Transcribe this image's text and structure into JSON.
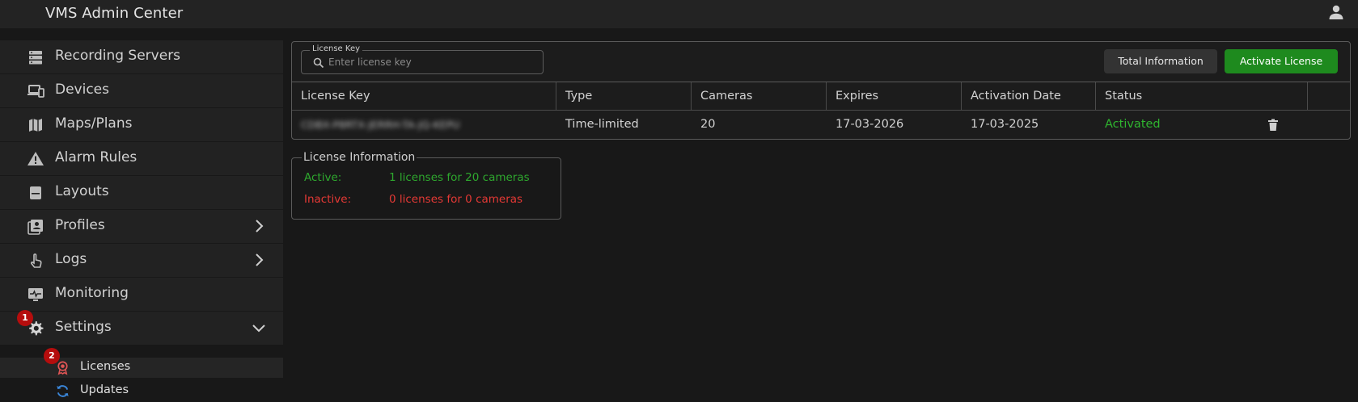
{
  "app": {
    "title": "VMS Admin Center"
  },
  "sidebar": {
    "items": [
      {
        "label": "Recording Servers",
        "icon": "server-icon"
      },
      {
        "label": "Devices",
        "icon": "devices-icon"
      },
      {
        "label": "Maps/Plans",
        "icon": "map-icon"
      },
      {
        "label": "Alarm Rules",
        "icon": "warning-icon"
      },
      {
        "label": "Layouts",
        "icon": "layout-icon"
      },
      {
        "label": "Profiles",
        "icon": "profiles-icon"
      },
      {
        "label": "Logs",
        "icon": "logs-icon"
      },
      {
        "label": "Monitoring",
        "icon": "monitor-icon"
      },
      {
        "label": "Settings",
        "icon": "gear-icon",
        "badge": "1"
      }
    ],
    "settings_sub": [
      {
        "label": "Licenses",
        "icon": "license-icon",
        "badge": "2"
      },
      {
        "label": "Updates",
        "icon": "refresh-icon"
      }
    ]
  },
  "search": {
    "legend": "License Key",
    "placeholder": "Enter license key",
    "value": ""
  },
  "toolbar": {
    "total_label": "Total Information",
    "activate_label": "Activate License"
  },
  "table": {
    "headers": [
      "License Key",
      "Type",
      "Cameras",
      "Expires",
      "Activation Date",
      "Status"
    ],
    "rows": [
      {
        "key": "CDBX-P8RTX-JERRH-TA-JQ-KEPU",
        "type": "Time-limited",
        "cameras": "20",
        "expires": "17-03-2026",
        "activation": "17-03-2025",
        "status": "Activated"
      }
    ]
  },
  "license_info": {
    "legend": "License Information",
    "active_label": "Active:",
    "active_value": "1 licenses for 20 cameras",
    "inactive_label": "Inactive:",
    "inactive_value": "0 licenses for 0 cameras"
  },
  "colors": {
    "accent_green": "#1e8a1e",
    "status_green": "#2fb52f",
    "badge_red": "#b50d0d",
    "inactive_red": "#e53935"
  }
}
